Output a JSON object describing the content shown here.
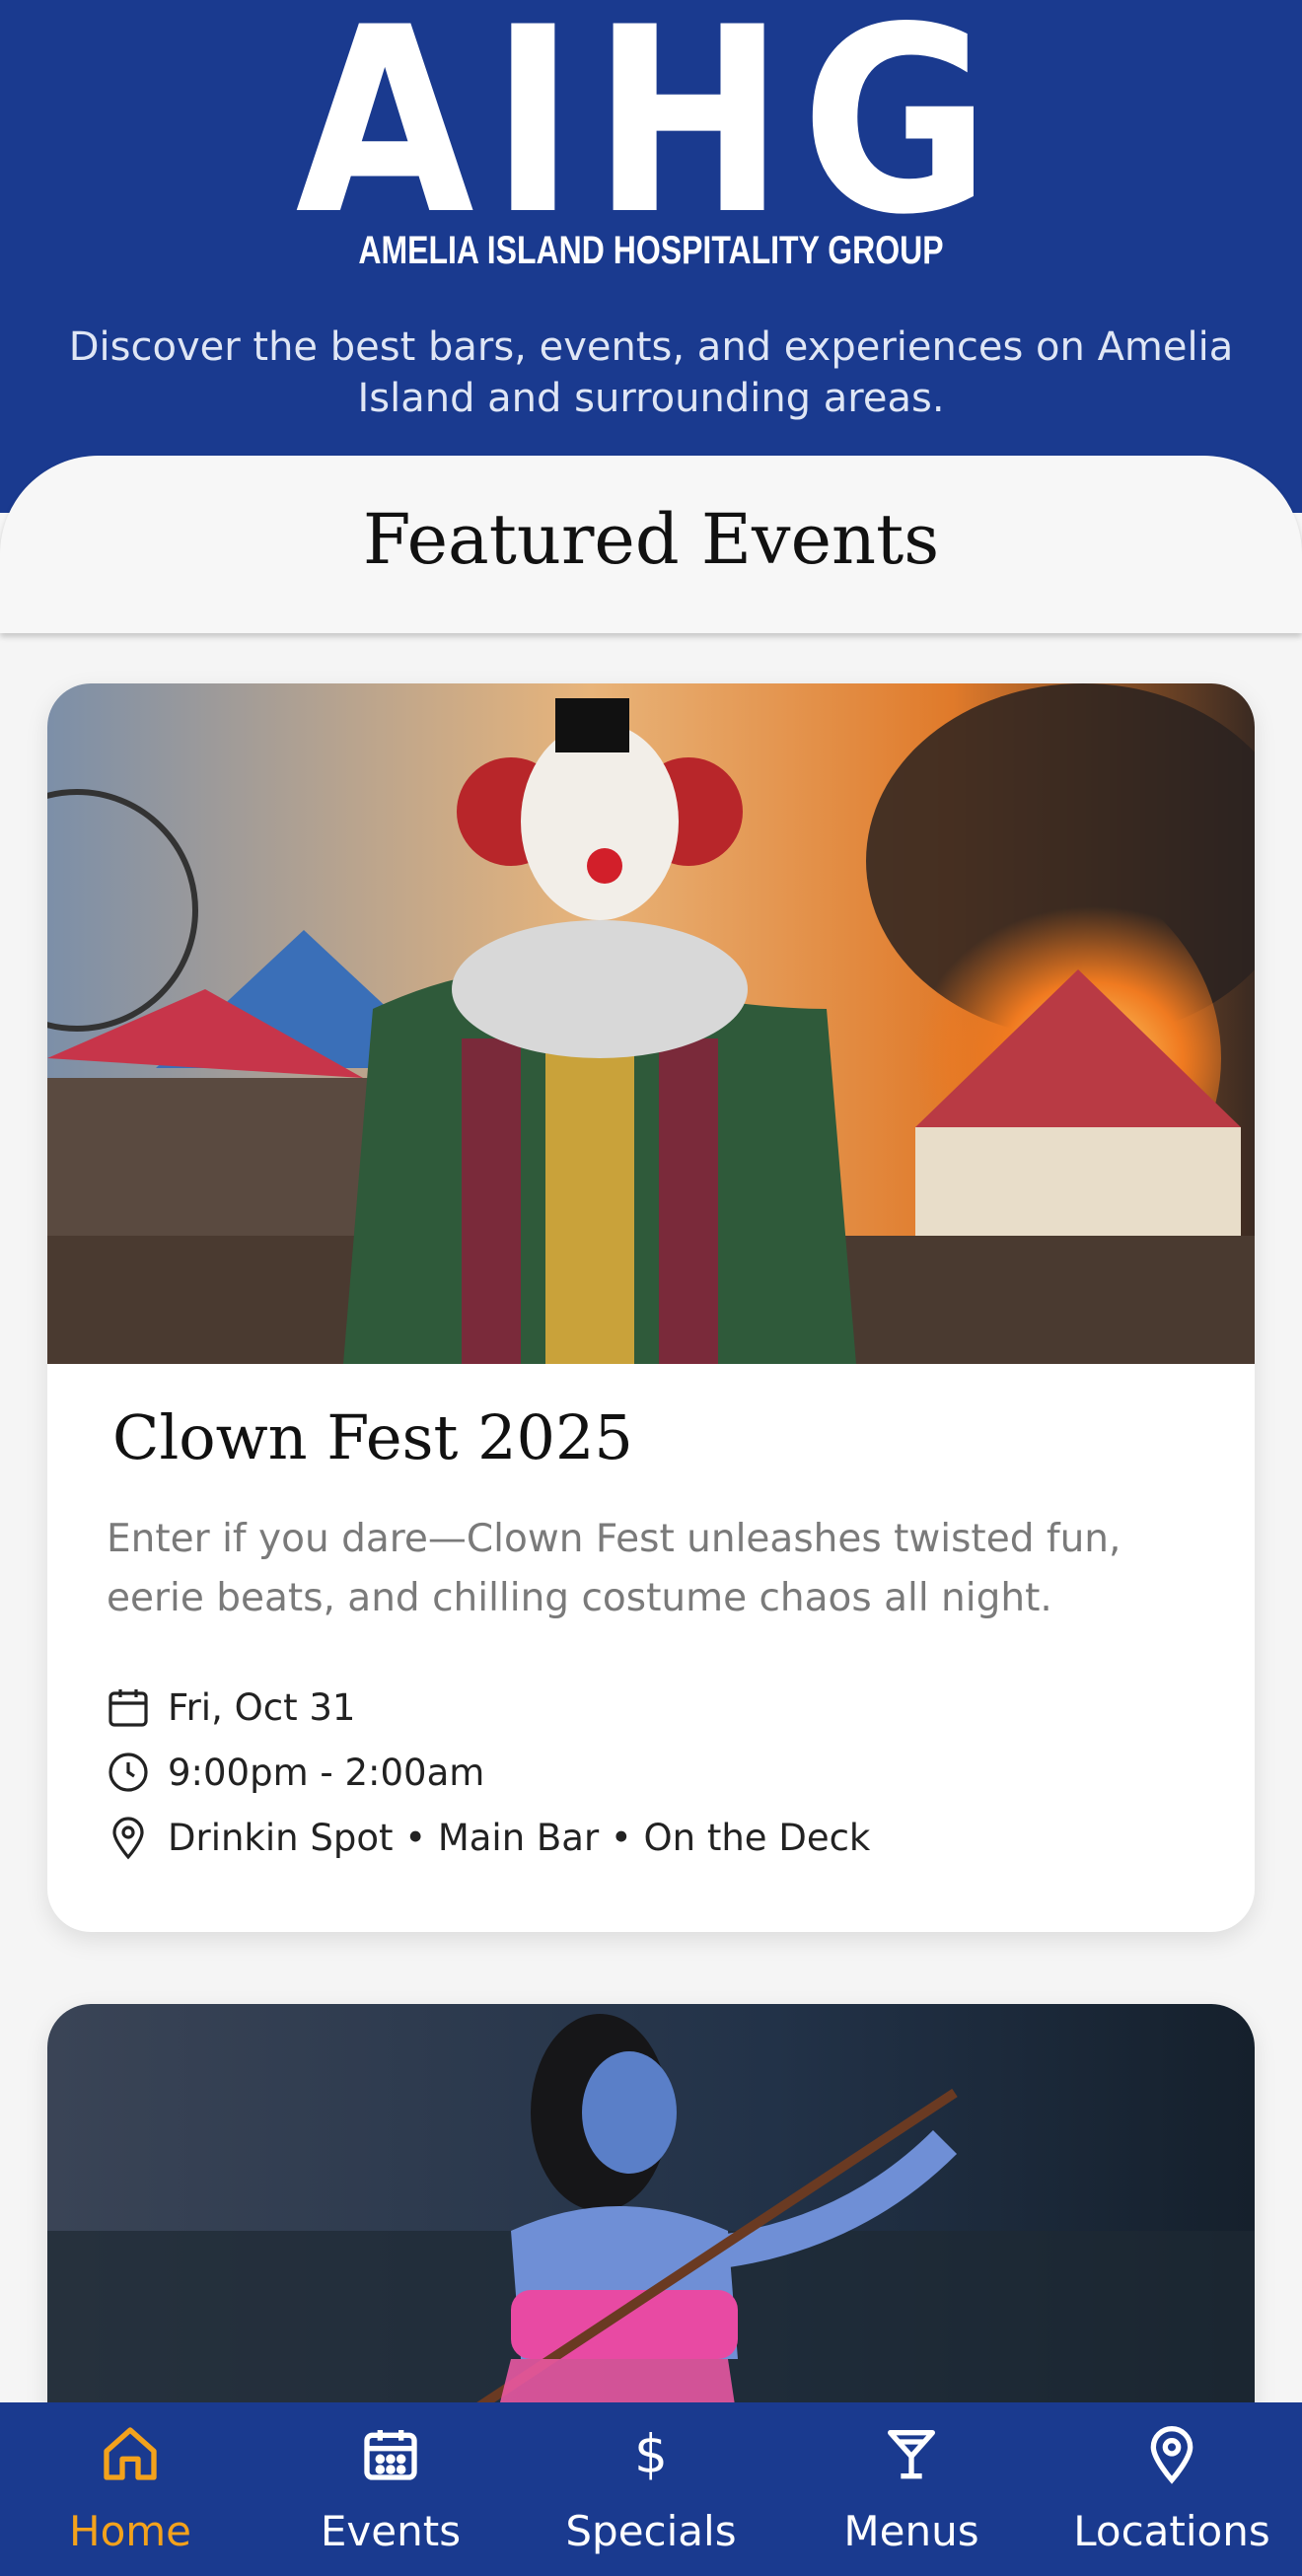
{
  "brand": {
    "logo_letters": "AIHG",
    "logo_subtitle": "AMELIA ISLAND HOSPITALITY GROUP",
    "tagline": "Discover the best bars, events, and experiences on Amelia Island and surrounding areas."
  },
  "section": {
    "title": "Featured Events"
  },
  "events": [
    {
      "title": "Clown Fest 2025",
      "description": "Enter if you dare—Clown Fest unleashes twisted fun, eerie beats, and chilling costume chaos all night.",
      "date": "Fri, Oct 31",
      "time": "9:00pm - 2:00am",
      "location": "Drinkin Spot • Main Bar • On the Deck",
      "image_icon": "clown-circus-photo"
    },
    {
      "image_icon": "dancer-with-pole-photo"
    }
  ],
  "nav": [
    {
      "label": "Home",
      "icon": "home-icon",
      "active": true
    },
    {
      "label": "Events",
      "icon": "calendar-icon",
      "active": false
    },
    {
      "label": "Specials",
      "icon": "dollar-icon",
      "active": false
    },
    {
      "label": "Menus",
      "icon": "cocktail-icon",
      "active": false
    },
    {
      "label": "Locations",
      "icon": "location-pin-icon",
      "active": false
    }
  ],
  "colors": {
    "brand_blue": "#1a3a8f",
    "active_orange": "#f3a21c",
    "background": "#f5f5f5"
  }
}
